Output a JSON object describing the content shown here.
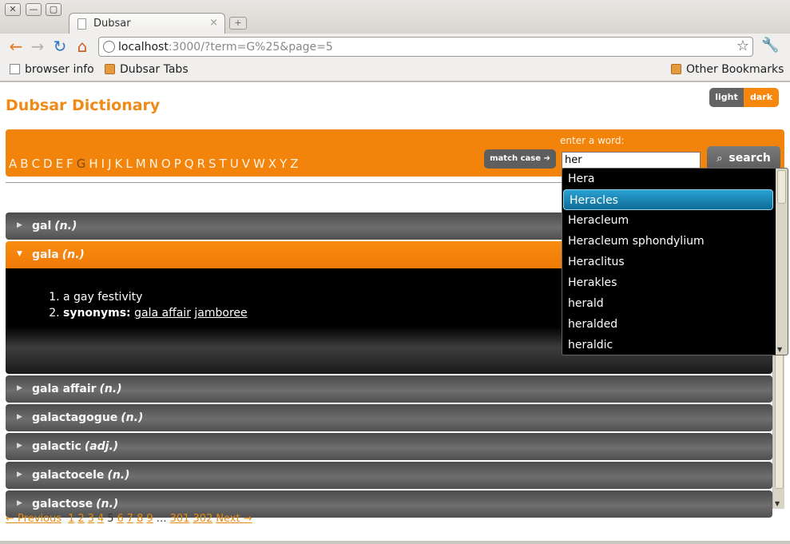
{
  "window": {
    "controls": [
      "✕",
      "—",
      "▢"
    ]
  },
  "tab": {
    "title": "Dubsar",
    "close": "×",
    "new_tab": "+"
  },
  "toolbar": {
    "back": "←",
    "forward": "→",
    "reload": "↻",
    "home": "⌂",
    "url_host": "localhost",
    "url_rest": ":3000/?term=G%25&page=5",
    "star": "☆",
    "wrench": "🔧"
  },
  "bookmarks": {
    "items": [
      "browser info",
      "Dubsar Tabs"
    ],
    "other": "Other Bookmarks"
  },
  "page": {
    "brand": "Dubsar Dictionary",
    "theme": {
      "light": "light",
      "dark": "dark"
    },
    "letters": [
      "A",
      "B",
      "C",
      "D",
      "E",
      "F",
      "G",
      "H",
      "I",
      "J",
      "K",
      "L",
      "M",
      "N",
      "O",
      "P",
      "Q",
      "R",
      "S",
      "T",
      "U",
      "V",
      "W",
      "X",
      "Y",
      "Z"
    ],
    "current_letter": "G",
    "match_case": "match case ➔",
    "prompt": "enter a word:",
    "search_value": "her",
    "search_button": "search",
    "search_icon": "⌕"
  },
  "entries": [
    {
      "word": "gal",
      "pos": "(n.)",
      "open": false
    },
    {
      "word": "gala",
      "pos": "(n.)",
      "open": true,
      "senses": [
        "a gay festivity"
      ],
      "synonyms_label": "synonyms:",
      "synonyms": [
        "gala affair",
        "jamboree"
      ]
    },
    {
      "word": "gala affair",
      "pos": "(n.)",
      "open": false
    },
    {
      "word": "galactagogue",
      "pos": "(n.)",
      "open": false
    },
    {
      "word": "galactic",
      "pos": "(adj.)",
      "open": false
    },
    {
      "word": "galactocele",
      "pos": "(n.)",
      "open": false
    },
    {
      "word": "galactose",
      "pos": "(n.)",
      "open": false
    }
  ],
  "autocomplete": {
    "items": [
      "Hera",
      "Heracles",
      "Heracleum",
      "Heracleum sphondylium",
      "Heraclitus",
      "Herakles",
      "herald",
      "heralded",
      "heraldic"
    ],
    "active_index": 1
  },
  "pager": {
    "previous": "← Previous",
    "pages_before": [
      "1",
      "2",
      "3",
      "4"
    ],
    "current": "5",
    "pages_after": [
      "6",
      "7",
      "8",
      "9"
    ],
    "ellipsis": "…",
    "last_pages": [
      "301",
      "302"
    ],
    "next": "Next →"
  }
}
